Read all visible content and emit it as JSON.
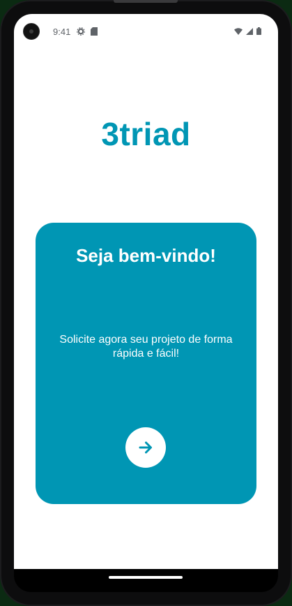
{
  "status_bar": {
    "time": "9:41"
  },
  "app": {
    "brand": "3triad"
  },
  "welcome_card": {
    "title": "Seja bem-vindo!",
    "text": "Solicite agora seu projeto de forma rápida e fácil!",
    "next_button_icon": "arrow-right-icon"
  },
  "colors": {
    "accent": "#0096b4",
    "background": "#ffffff",
    "card_text": "#ffffff"
  }
}
